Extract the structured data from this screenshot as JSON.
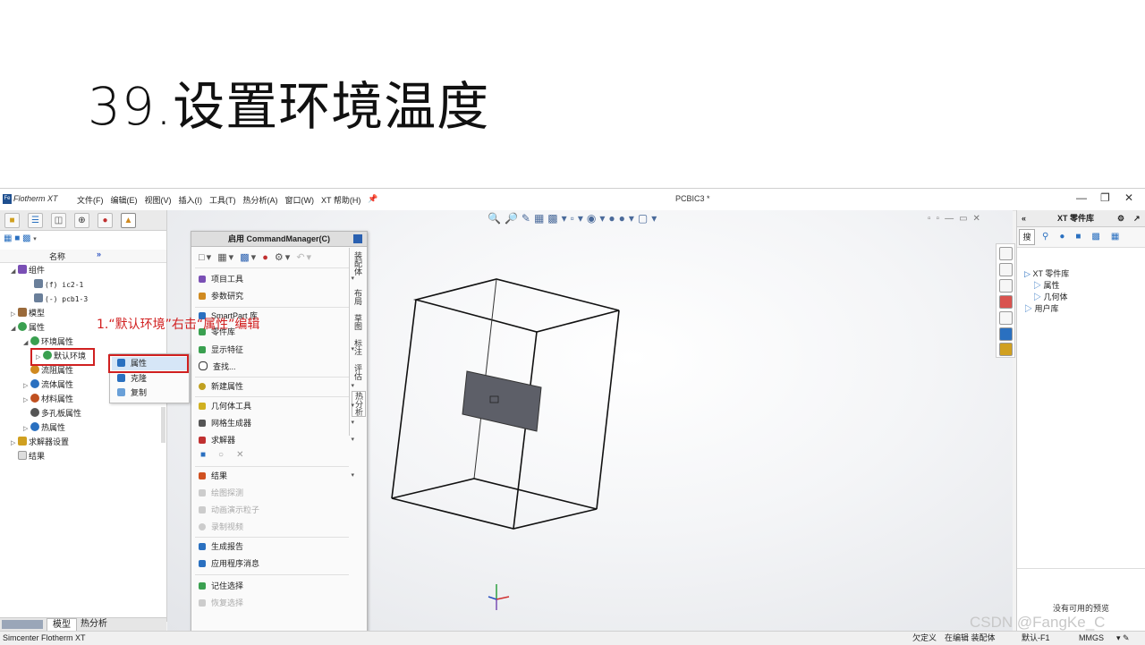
{
  "slide": {
    "title": "39.设置环境温度"
  },
  "app": {
    "logo": "Fe",
    "name": "Flotherm XT",
    "menu": [
      "文件(F)",
      "编辑(E)",
      "视图(V)",
      "插入(I)",
      "工具(T)",
      "热分析(A)",
      "窗口(W)",
      "XT 帮助(H)"
    ],
    "document_title": "PCBIC3 *"
  },
  "left_panel": {
    "column_header": "名称",
    "column_more": "»",
    "tree": [
      {
        "label": "组件",
        "level": 1,
        "icon": "assembly-icon",
        "color": "#7a4fb5"
      },
      {
        "label": "(f) ic2-1",
        "level": 2,
        "icon": "part-icon",
        "color": "#6a7f9a"
      },
      {
        "label": "(-) pcb1-3",
        "level": 2,
        "icon": "part-icon",
        "color": "#6a7f9a"
      },
      {
        "label": "模型",
        "level": 0,
        "icon": "model-icon",
        "color": "#9a6a3a"
      },
      {
        "label": "属性",
        "level": 0,
        "icon": "properties-icon",
        "color": "#3aa050"
      },
      {
        "label": "环境属性",
        "level": 1,
        "icon": "environment-icon",
        "color": "#3aa050"
      },
      {
        "label": "默认环境",
        "level": 2,
        "icon": "default-env-icon",
        "color": "#3aa050"
      },
      {
        "label": "流阻属性",
        "level": 1,
        "icon": "flow-resistance-icon",
        "color": "#d08a20"
      },
      {
        "label": "流体属性",
        "level": 1,
        "icon": "fluid-icon",
        "color": "#2a70c0"
      },
      {
        "label": "材料属性",
        "level": 1,
        "icon": "material-icon",
        "color": "#c05020"
      },
      {
        "label": "多孔板属性",
        "level": 1,
        "icon": "perforated-plate-icon",
        "color": "#555555"
      },
      {
        "label": "热属性",
        "level": 1,
        "icon": "thermal-icon",
        "color": "#2a70c0"
      },
      {
        "label": "求解器设置",
        "level": 0,
        "icon": "solver-icon",
        "color": "#d0a020"
      },
      {
        "label": "结果",
        "level": 0,
        "icon": "results-icon",
        "color": "#999999"
      }
    ],
    "bottom_tabs": [
      "模型",
      "热分析"
    ]
  },
  "annotation": "1.“默认环境”右击“属性”编辑",
  "context_menu": {
    "items": [
      {
        "label": "属性",
        "color": "#2a70c0"
      },
      {
        "label": "克隆",
        "color": "#2a70c0"
      },
      {
        "label": "复制",
        "color": "#6aa0d8"
      }
    ]
  },
  "command_manager": {
    "title": "启用 CommandManager(C)",
    "side_tabs": [
      "装配体",
      "布局",
      "草图",
      "标注",
      "评估",
      "热分析"
    ],
    "rows": [
      {
        "label": "项目工具",
        "arrow": true,
        "disabled": false,
        "color": "#7a4fb5"
      },
      {
        "label": "参数研究",
        "arrow": false,
        "disabled": false,
        "color": "#d08a20"
      },
      {
        "label": "SmartPart 库",
        "arrow": false,
        "disabled": false,
        "color": "#2a70c0"
      },
      {
        "label": "零件库",
        "arrow": false,
        "disabled": false,
        "color": "#3aa050"
      },
      {
        "label": "显示特征",
        "arrow": true,
        "disabled": false,
        "color": "#3aa050"
      },
      {
        "label": "查找...",
        "arrow": false,
        "disabled": false,
        "color": "#333333"
      },
      {
        "label": "新建属性",
        "arrow": true,
        "disabled": false,
        "color": "#c0a020"
      },
      {
        "label": "几何体工具",
        "arrow": true,
        "disabled": false,
        "color": "#d0b020"
      },
      {
        "label": "网格生成器",
        "arrow": true,
        "disabled": false,
        "color": "#555555"
      },
      {
        "label": "求解器",
        "arrow": true,
        "disabled": false,
        "color": "#c03030"
      },
      {
        "label": "结果",
        "arrow": true,
        "disabled": false,
        "color": "#d05020"
      },
      {
        "label": "绘图探测",
        "arrow": false,
        "disabled": true,
        "color": "#bbbbbb"
      },
      {
        "label": "动画演示粒子",
        "arrow": false,
        "disabled": true,
        "color": "#bbbbbb"
      },
      {
        "label": "录制视频",
        "arrow": false,
        "disabled": true,
        "color": "#bbbbbb"
      },
      {
        "label": "生成报告",
        "arrow": false,
        "disabled": false,
        "color": "#2a70c0"
      },
      {
        "label": "应用程序消息",
        "arrow": false,
        "disabled": false,
        "color": "#2a70c0"
      },
      {
        "label": "记住选择",
        "arrow": false,
        "disabled": false,
        "color": "#3aa050"
      },
      {
        "label": "恢复选择",
        "arrow": false,
        "disabled": true,
        "color": "#bbbbbb"
      }
    ]
  },
  "right_panel": {
    "title": "XT 零件库",
    "search_tab": "搜",
    "tree": [
      "XT 零件库",
      "属性",
      "几何体",
      "用户库"
    ],
    "preview_text": "没有可用的预览"
  },
  "statusbar": {
    "left": "Simcenter Flotherm XT",
    "items": [
      "欠定义",
      "在编辑 装配体",
      "默认-F1",
      "MMGS"
    ]
  },
  "watermark": "CSDN @FangKe_C"
}
